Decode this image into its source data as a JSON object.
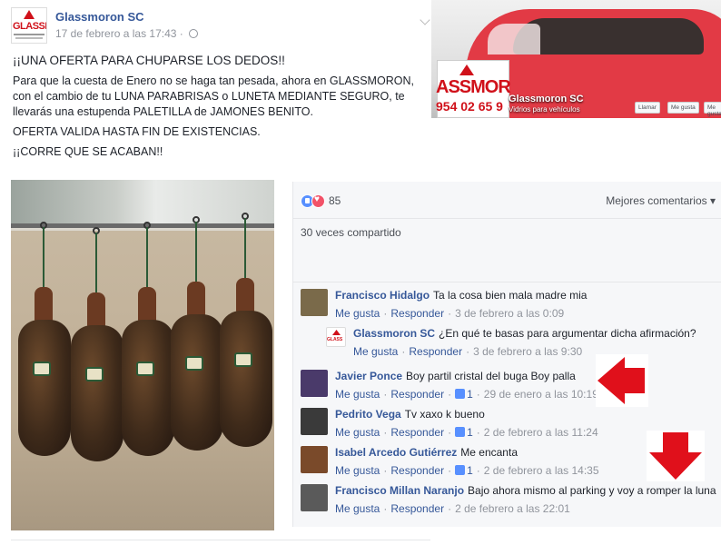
{
  "post": {
    "page_name": "Glassmoron SC",
    "timestamp": "17 de febrero a las 17:43 · ",
    "lines": [
      "¡¡UNA OFERTA PARA CHUPARSE LOS DEDOS!!",
      "Para que la cuesta de Enero no se haga tan pesada, ahora en GLASSMORON, con el cambio de tu LUNA PARABRISAS o LUNETA MEDIANTE SEGURO, te llevarás una estupenda PALETILLA de JAMONES BENITO.",
      "OFERTA VALIDA HASTA FIN DE EXISTENCIAS.",
      "¡¡CORRE QUE SE ACABAN!!"
    ]
  },
  "cover": {
    "logo_text": "ASSMOR",
    "logo_phone": "954 02 65 9",
    "name": "Glassmoron SC",
    "subtitle": "Vidrios para vehículos",
    "buttons": [
      "Llamar",
      "Me gusta",
      "Me gusta"
    ]
  },
  "avatar": {
    "logo_text": "GLASSMOR"
  },
  "reactions": {
    "count": "85",
    "types": [
      "like-icon",
      "love-icon"
    ]
  },
  "sort_label": "Mejores comentarios ▾",
  "shares": "30 veces compartido",
  "actions": {
    "like": "Me gusta",
    "reply": "Responder"
  },
  "comments": [
    {
      "name": "Francisco Hidalgo",
      "text": "Ta la cosa bien mala madre mia",
      "likes": "",
      "time": "3 de febrero a las 0:09",
      "avatar_color": "#7a6a4a",
      "reply": false
    },
    {
      "name": "Glassmoron SC",
      "text": "¿En qué te basas para argumentar dicha afirmación?",
      "likes": "",
      "time": "3 de febrero a las 9:30",
      "avatar_color": "#ffffff",
      "reply": true
    },
    {
      "name": "Javier Ponce",
      "text": "Boy partil cristal del buga Boy palla",
      "likes": "1",
      "time": "29 de enero a las 10:19",
      "avatar_color": "#4a3a6a",
      "reply": false
    },
    {
      "name": "Pedrito Vega",
      "text": "Tv xaxo k bueno",
      "likes": "1",
      "time": "2 de febrero a las 11:24",
      "avatar_color": "#3a3a3a",
      "reply": false
    },
    {
      "name": "Isabel Arcedo Gutiérrez",
      "text": "Me encanta",
      "likes": "1",
      "time": "2 de febrero a las 14:35",
      "avatar_color": "#7a4a2a",
      "reply": false
    },
    {
      "name": "Francisco Millan Naranjo",
      "text": "Bajo ahora mismo al parking y voy a romper la luna",
      "likes": "",
      "time": "2 de febrero a las 22:01",
      "avatar_color": "#5a5a5a",
      "reply": false
    }
  ],
  "colors": {
    "link": "#365899",
    "meta": "#90949c",
    "brand_red": "#d0111a",
    "arrow_red": "#e0101b"
  }
}
